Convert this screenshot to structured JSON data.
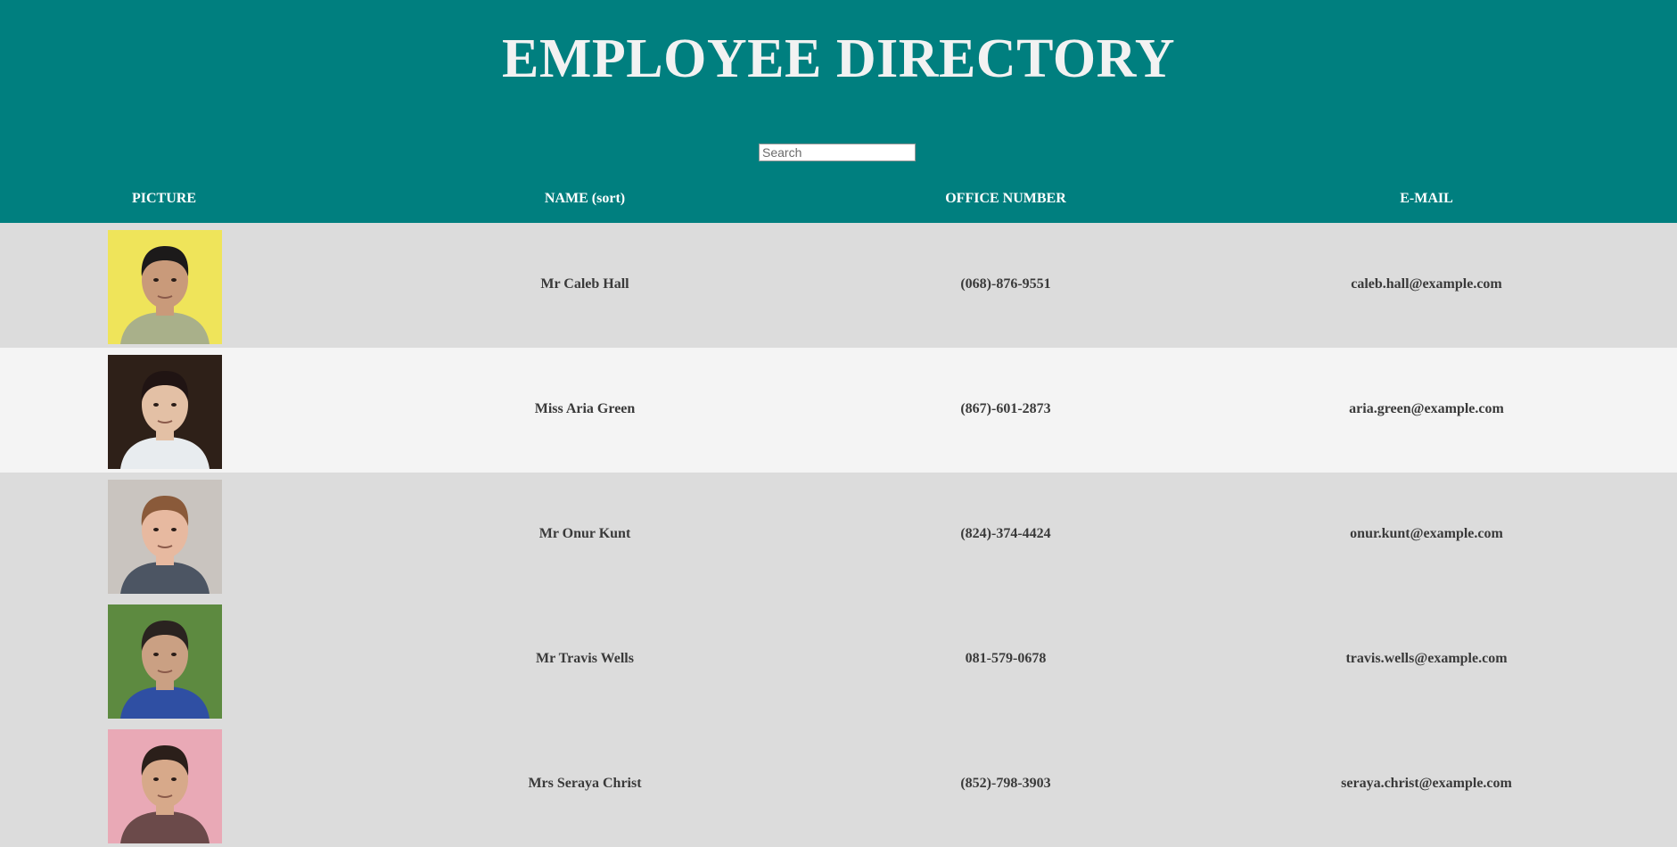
{
  "title": "EMPLOYEE DIRECTORY",
  "search": {
    "placeholder": "Search",
    "value": ""
  },
  "columns": {
    "picture": "PICTURE",
    "name": "NAME (sort)",
    "office": "OFFICE NUMBER",
    "email": "E-MAIL"
  },
  "colors": {
    "header_bg": "#007f7f",
    "row_dark": "#dcdcdc",
    "row_light": "#f4f4f4"
  },
  "employees": [
    {
      "name": "Mr Caleb Hall",
      "office": "(068)-876-9551",
      "email": "caleb.hall@example.com",
      "row_color": "#dcdcdc",
      "photo": {
        "bg": "#efe45a",
        "skin": "#c99a7a",
        "hair": "#1c1a1a",
        "shirt": "#a9b08a"
      }
    },
    {
      "name": "Miss Aria Green",
      "office": "(867)-601-2873",
      "email": "aria.green@example.com",
      "row_color": "#f4f4f4",
      "photo": {
        "bg": "#2e2018",
        "skin": "#e3c0a5",
        "hair": "#201413",
        "shirt": "#e8ecef"
      }
    },
    {
      "name": "Mr Onur Kunt",
      "office": "(824)-374-4424",
      "email": "onur.kunt@example.com",
      "row_color": "#dcdcdc",
      "photo": {
        "bg": "#c9c4bf",
        "skin": "#e7b9a0",
        "hair": "#8a5a3a",
        "shirt": "#4c5563"
      }
    },
    {
      "name": "Mr Travis Wells",
      "office": "081-579-0678",
      "email": "travis.wells@example.com",
      "row_color": "#dcdcdc",
      "photo": {
        "bg": "#5d8a40",
        "skin": "#caa083",
        "hair": "#2a2320",
        "shirt": "#2f4fa3"
      }
    },
    {
      "name": "Mrs Seraya Christ",
      "office": "(852)-798-3903",
      "email": "seraya.christ@example.com",
      "row_color": "#dcdcdc",
      "photo": {
        "bg": "#e9a9b6",
        "skin": "#d7a98a",
        "hair": "#2b1f1a",
        "shirt": "#6b4a4a"
      }
    }
  ]
}
